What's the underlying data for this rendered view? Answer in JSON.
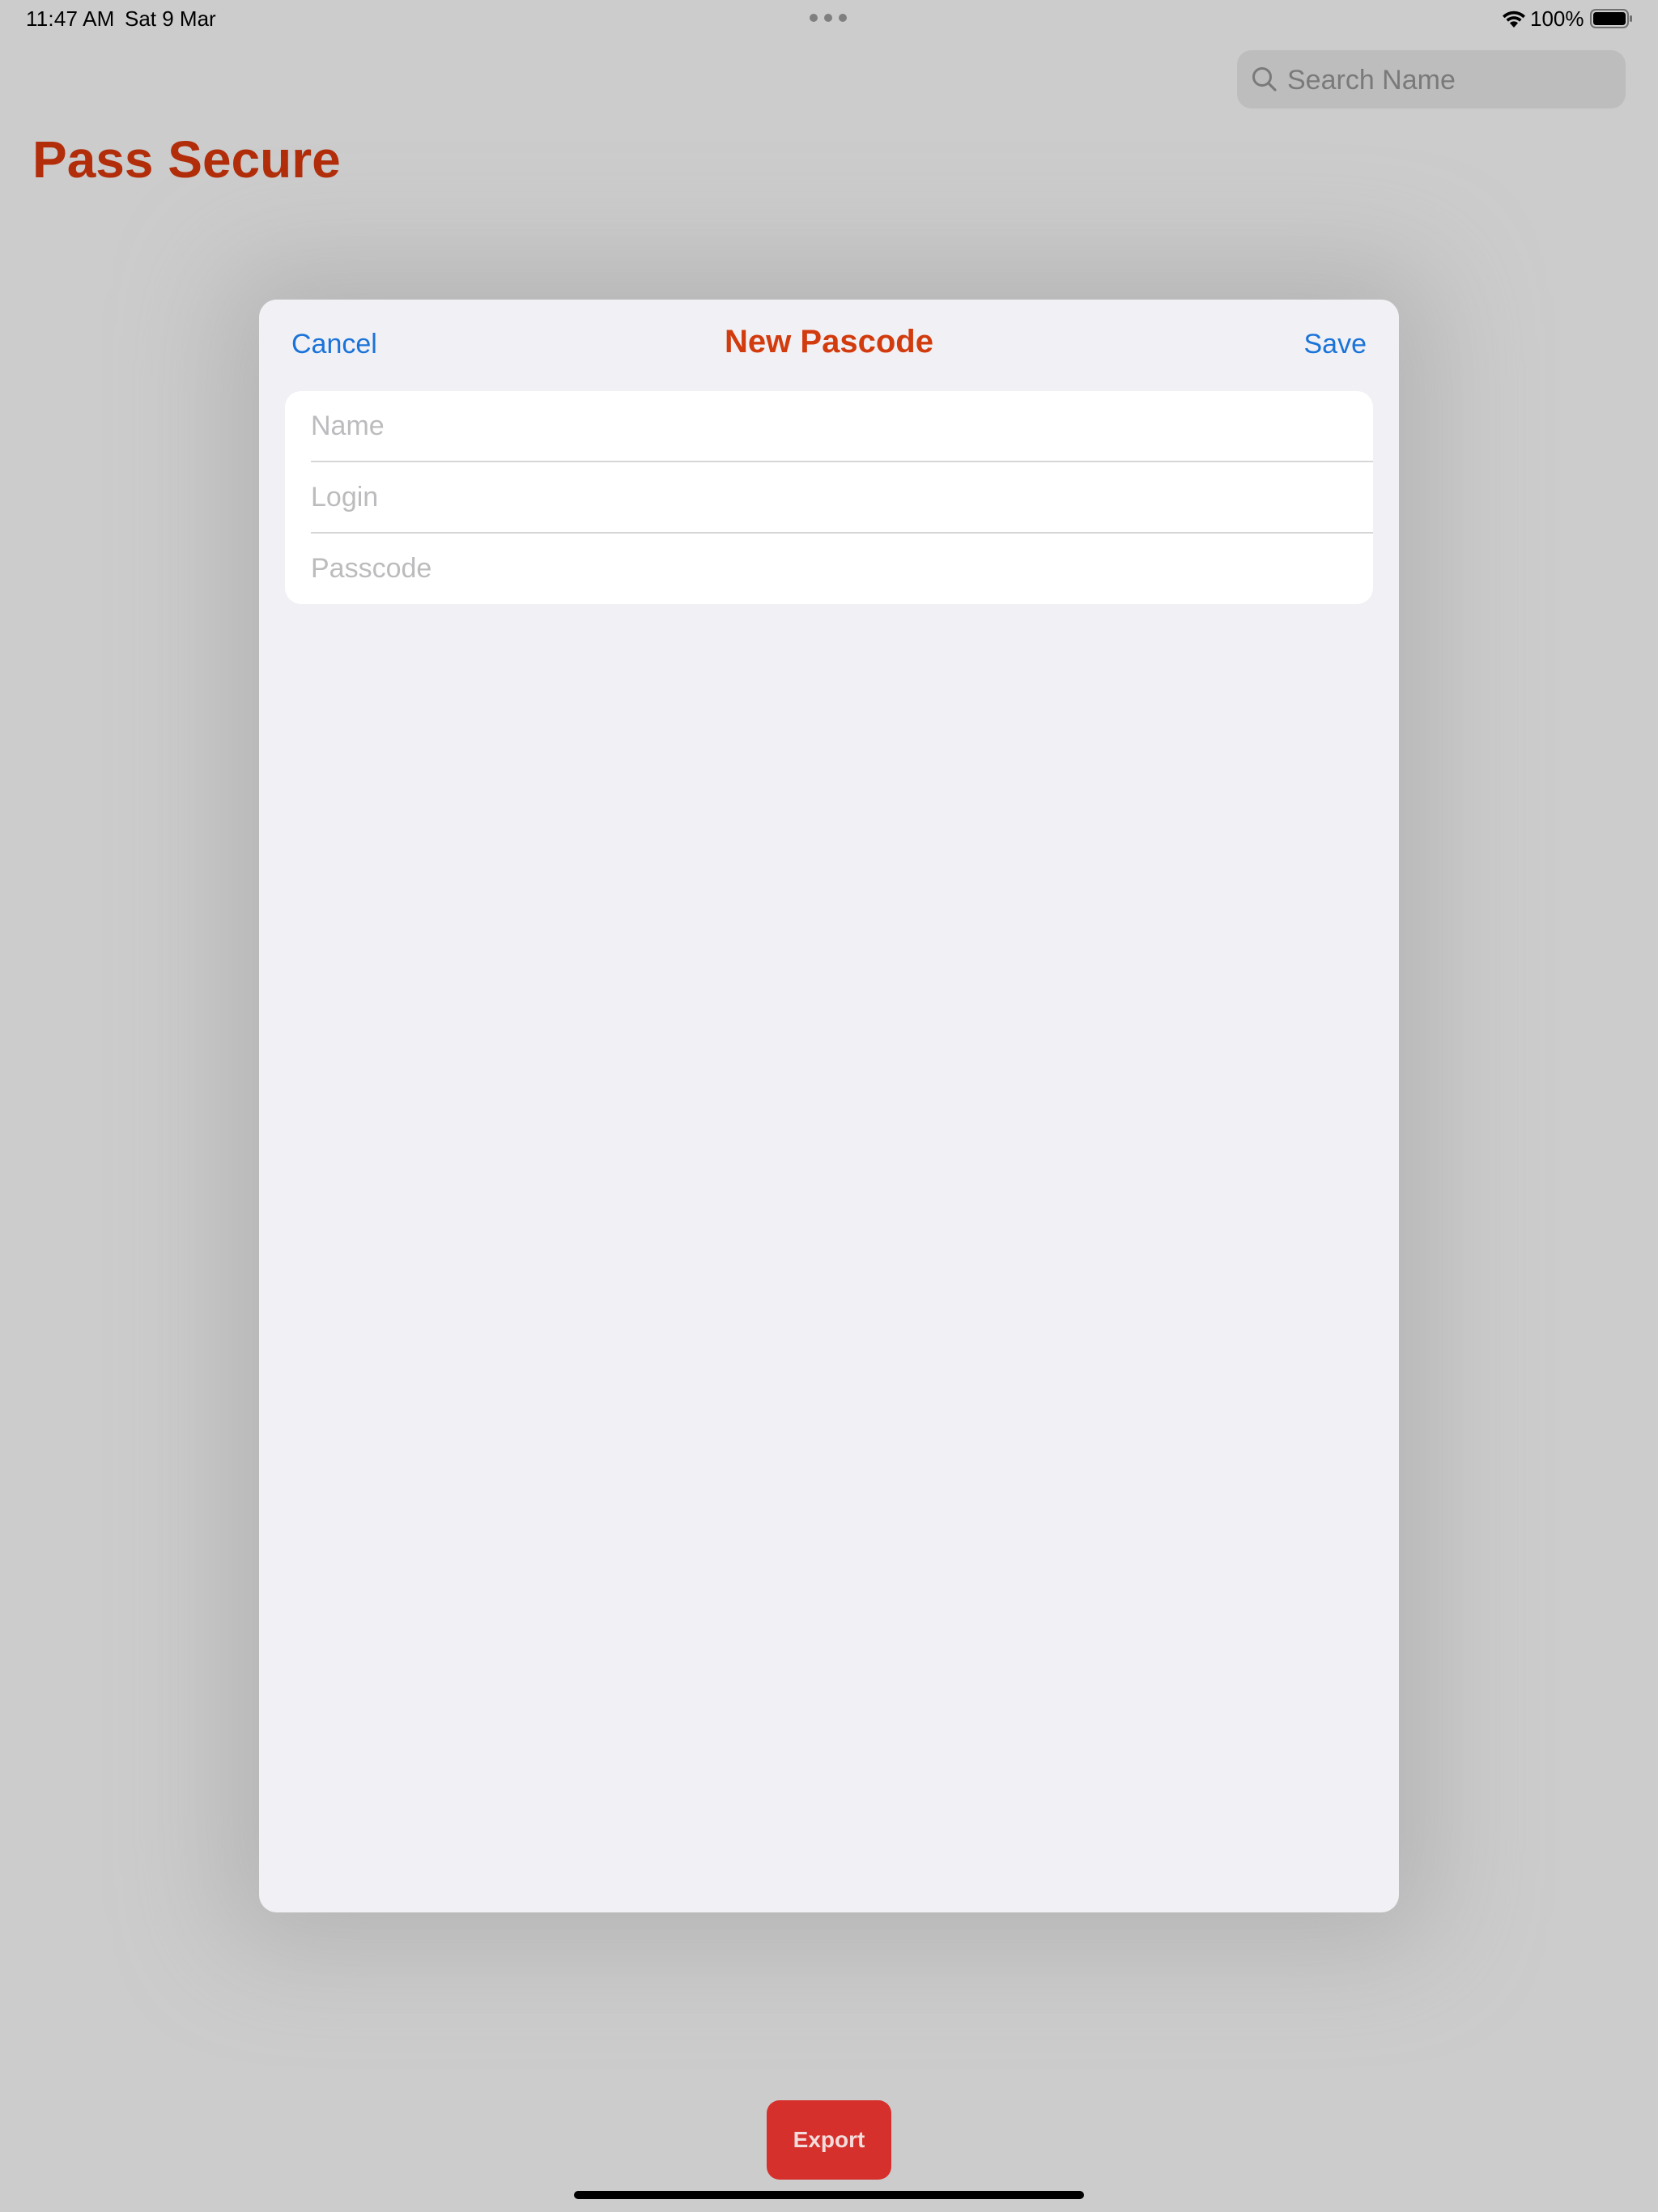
{
  "status_bar": {
    "time": "11:47 AM",
    "date": "Sat 9 Mar",
    "battery": "100%"
  },
  "search": {
    "placeholder": "Search Name"
  },
  "app": {
    "title": "Pass Secure",
    "accent_color": "#b22d0a"
  },
  "modal": {
    "cancel_label": "Cancel",
    "title": "New Pascode",
    "save_label": "Save",
    "title_color": "#d23b0e",
    "link_color": "#1a73d9",
    "fields": [
      {
        "placeholder": "Name",
        "value": ""
      },
      {
        "placeholder": "Login",
        "value": ""
      },
      {
        "placeholder": "Passcode",
        "value": ""
      }
    ]
  },
  "footer": {
    "export_label": "Export",
    "export_color": "#d5302c"
  },
  "icons": {
    "search": "search-icon",
    "wifi": "wifi-icon",
    "battery": "battery-icon",
    "multitask": "multitask-dots-icon"
  }
}
